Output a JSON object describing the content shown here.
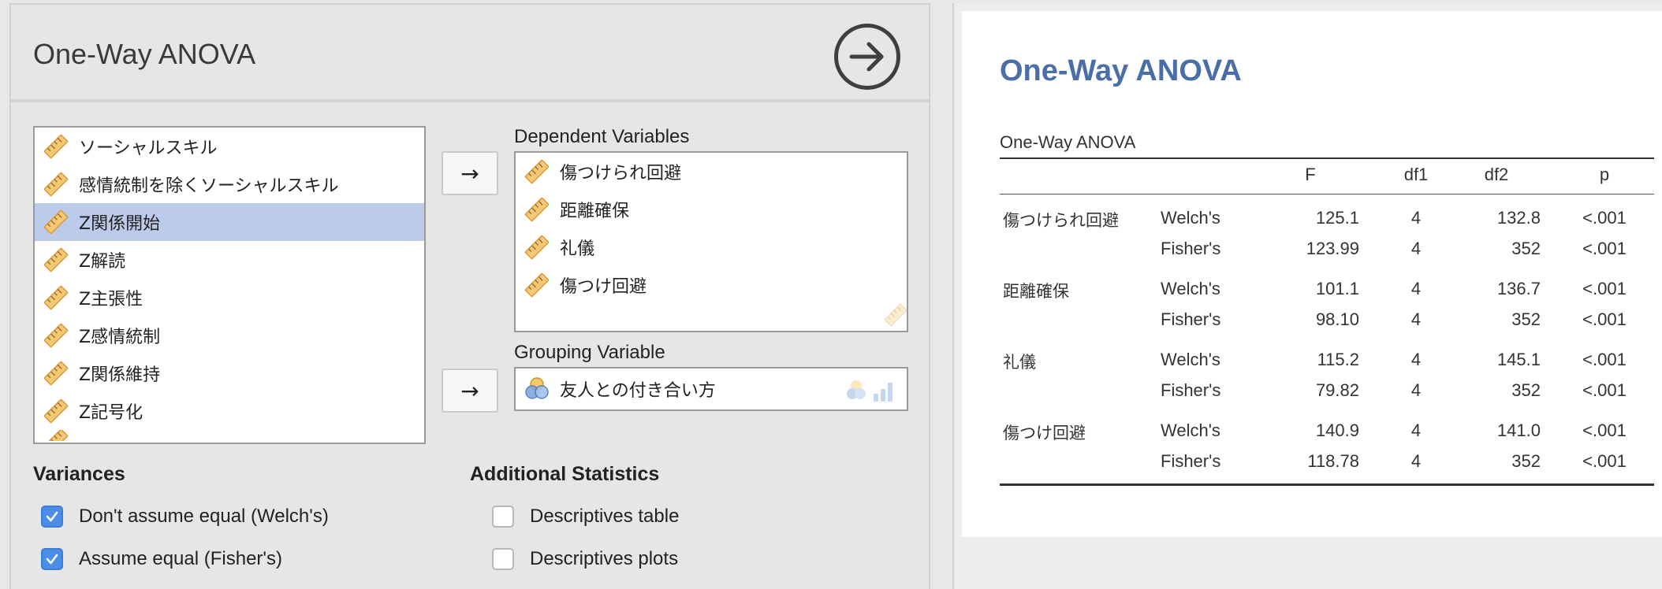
{
  "options": {
    "title": "One-Way ANOVA",
    "available_variables": [
      {
        "label": "ソーシャルスキル",
        "selected": false
      },
      {
        "label": "感情統制を除くソーシャルスキル",
        "selected": false
      },
      {
        "label": "Z関係開始",
        "selected": true
      },
      {
        "label": "Z解読",
        "selected": false
      },
      {
        "label": "Z主張性",
        "selected": false
      },
      {
        "label": "Z感情統制",
        "selected": false
      },
      {
        "label": "Z関係維持",
        "selected": false
      },
      {
        "label": "Z記号化",
        "selected": false
      }
    ],
    "dependent_variables": {
      "label": "Dependent Variables",
      "items": [
        "傷つけられ回避",
        "距離確保",
        "礼儀",
        "傷つけ回避"
      ]
    },
    "grouping_variable": {
      "label": "Grouping Variable",
      "value": "友人との付き合い方"
    },
    "variances": {
      "title": "Variances",
      "options": [
        {
          "label": "Don't assume equal (Welch's)",
          "checked": true
        },
        {
          "label": "Assume equal (Fisher's)",
          "checked": true
        }
      ]
    },
    "additional_statistics": {
      "title": "Additional Statistics",
      "options": [
        {
          "label": "Descriptives table",
          "checked": false
        },
        {
          "label": "Descriptives plots",
          "checked": false
        }
      ]
    },
    "move_arrow": "→"
  },
  "results": {
    "heading": "One-Way ANOVA",
    "table_caption": "One-Way ANOVA",
    "columns": [
      "",
      "",
      "F",
      "df1",
      "df2",
      "p"
    ],
    "rows": [
      {
        "variable": "傷つけられ回避",
        "test": "Welch's",
        "F": "125.1",
        "df1": "4",
        "df2": "132.8",
        "p": "<.001"
      },
      {
        "variable": "",
        "test": "Fisher's",
        "F": "123.99",
        "df1": "4",
        "df2": "352",
        "p": "<.001"
      },
      {
        "variable": "距離確保",
        "test": "Welch's",
        "F": "101.1",
        "df1": "4",
        "df2": "136.7",
        "p": "<.001"
      },
      {
        "variable": "",
        "test": "Fisher's",
        "F": "98.10",
        "df1": "4",
        "df2": "352",
        "p": "<.001"
      },
      {
        "variable": "礼儀",
        "test": "Welch's",
        "F": "115.2",
        "df1": "4",
        "df2": "145.1",
        "p": "<.001"
      },
      {
        "variable": "",
        "test": "Fisher's",
        "F": "79.82",
        "df1": "4",
        "df2": "352",
        "p": "<.001"
      },
      {
        "variable": "傷つけ回避",
        "test": "Welch's",
        "F": "140.9",
        "df1": "4",
        "df2": "141.0",
        "p": "<.001"
      },
      {
        "variable": "",
        "test": "Fisher's",
        "F": "118.78",
        "df1": "4",
        "df2": "352",
        "p": "<.001"
      }
    ]
  },
  "icons": {
    "run": "run-analysis-arrow-icon",
    "continuous_variable": "ruler-icon",
    "nominal_variable": "venn-circles-icon",
    "checkmark": "checkmark-icon"
  },
  "colors": {
    "selection": "#bccbe9",
    "heading_blue": "#4a6ea8",
    "checkbox_blue": "#4a8ee8",
    "ruler_orange": "#e9a33c"
  }
}
